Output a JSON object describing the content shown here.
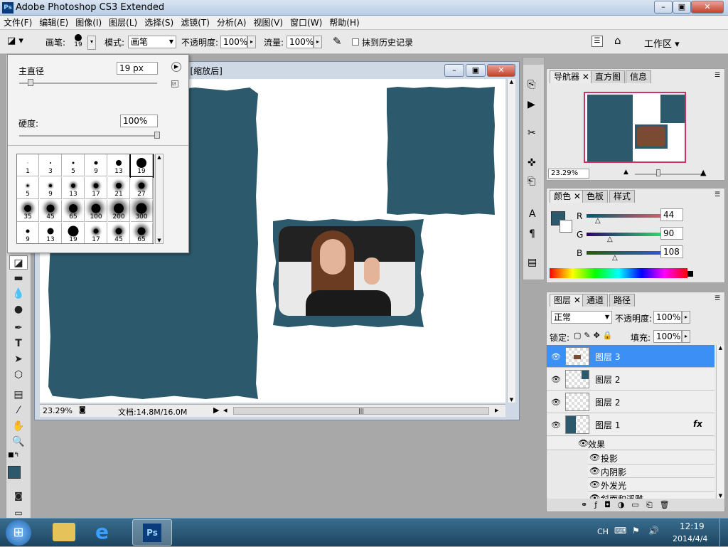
{
  "app": {
    "title": "Adobe Photoshop CS3 Extended",
    "icon": "Ps"
  },
  "window_controls": {
    "minimize": "–",
    "restore": "▣",
    "close": "✕"
  },
  "menu": [
    "文件(F)",
    "编辑(E)",
    "图像(I)",
    "图层(L)",
    "选择(S)",
    "滤镜(T)",
    "分析(A)",
    "视图(V)",
    "窗口(W)",
    "帮助(H)"
  ],
  "options": {
    "brush_label": "画笔:",
    "brush_size": "19",
    "mode_label": "模式:",
    "mode_value": "画笔",
    "opacity_label": "不透明度:",
    "opacity_value": "100%",
    "flow_label": "流量:",
    "flow_value": "100%",
    "erase_history_label": "抹到历史记录",
    "workspace_label": "工作区 ▾"
  },
  "brush_panel": {
    "diameter_label": "主直径",
    "diameter_value": "19 px",
    "hardness_label": "硬度:",
    "hardness_value": "100%",
    "presets": [
      {
        "n": "1",
        "d": 1,
        "soft": false
      },
      {
        "n": "3",
        "d": 2,
        "soft": false
      },
      {
        "n": "5",
        "d": 3,
        "soft": false
      },
      {
        "n": "9",
        "d": 5,
        "soft": false
      },
      {
        "n": "13",
        "d": 8,
        "soft": false
      },
      {
        "n": "19",
        "d": 14,
        "soft": false
      },
      {
        "n": "5",
        "d": 3,
        "soft": true
      },
      {
        "n": "9",
        "d": 4,
        "soft": true
      },
      {
        "n": "13",
        "d": 6,
        "soft": true
      },
      {
        "n": "17",
        "d": 7,
        "soft": true
      },
      {
        "n": "21",
        "d": 8,
        "soft": true
      },
      {
        "n": "27",
        "d": 9,
        "soft": true
      },
      {
        "n": "35",
        "d": 10,
        "soft": true
      },
      {
        "n": "45",
        "d": 11,
        "soft": true
      },
      {
        "n": "65",
        "d": 12,
        "soft": true
      },
      {
        "n": "100",
        "d": 13,
        "soft": true
      },
      {
        "n": "200",
        "d": 14,
        "soft": true
      },
      {
        "n": "300",
        "d": 15,
        "soft": true
      },
      {
        "n": "9",
        "d": 5,
        "soft": false
      },
      {
        "n": "13",
        "d": 9,
        "soft": false
      },
      {
        "n": "19",
        "d": 15,
        "soft": false
      },
      {
        "n": "17",
        "d": 7,
        "soft": true
      },
      {
        "n": "45",
        "d": 9,
        "soft": true
      },
      {
        "n": "65",
        "d": 11,
        "soft": true
      }
    ]
  },
  "document": {
    "title_suffix": ") [缩放后]",
    "zoom": "23.29%",
    "doc_info": "文档:14.8M/16.0M"
  },
  "navigator": {
    "tabs": [
      "导航器",
      "直方图",
      "信息"
    ],
    "zoom": "23.29%"
  },
  "color": {
    "tabs": [
      "颜色",
      "色板",
      "样式"
    ],
    "channels": [
      {
        "label": "R",
        "value": "44"
      },
      {
        "label": "G",
        "value": "90"
      },
      {
        "label": "B",
        "value": "108"
      }
    ],
    "foreground": "#2c5a6c"
  },
  "layers": {
    "tabs": [
      "图层",
      "通道",
      "路径"
    ],
    "blend_mode": "正常",
    "opacity_label": "不透明度:",
    "opacity_value": "100%",
    "lock_label": "锁定:",
    "fill_label": "填充:",
    "fill_value": "100%",
    "rows": [
      {
        "name": "图层 3",
        "selected": true
      },
      {
        "name": "图层 2",
        "selected": false
      },
      {
        "name": "图层 2",
        "selected": false
      },
      {
        "name": "图层 1",
        "selected": false,
        "fx": "fx"
      }
    ],
    "effects_label": "效果",
    "effects": [
      "投影",
      "内阴影",
      "外发光",
      "斜面和浮雕"
    ]
  },
  "taskbar": {
    "lang": "CH",
    "time": "12:19",
    "date": "2014/4/4",
    "ps_label": "Ps"
  }
}
